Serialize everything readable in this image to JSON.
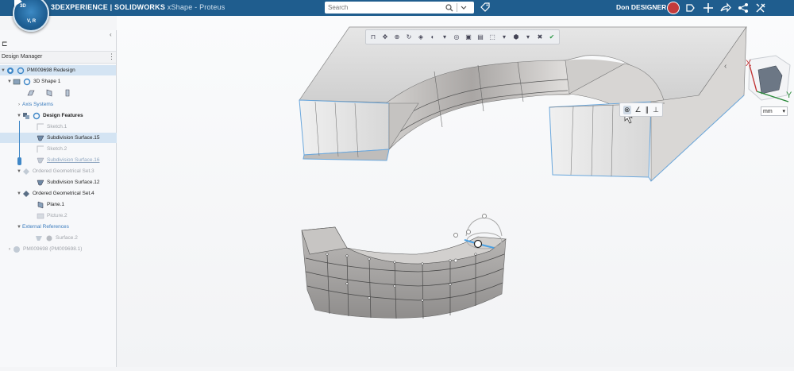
{
  "topbar": {
    "brand_strong": "3DEXPERIENCE | SOLIDWORKS",
    "brand_app": " xShape - Proteus",
    "compass_top": "3D",
    "compass_version": "V, R",
    "search_placeholder": "Search",
    "user_name": "Don DESIGNER",
    "icons": [
      "tag-icon",
      "share-icon",
      "plus-icon",
      "forward-icon",
      "network-icon",
      "tools-icon"
    ]
  },
  "sidebar": {
    "title": "Design Manager",
    "tree": [
      {
        "label": "PM009698 Redesign"
      },
      {
        "label": "3D Shape 1"
      },
      {
        "label": "Axis Systems"
      },
      {
        "label": "Design Features"
      },
      {
        "label": "Sketch.1"
      },
      {
        "label": "Subdivision Surface.15"
      },
      {
        "label": "Sketch.2"
      },
      {
        "label": "Subdivision Surface.16"
      },
      {
        "label": "Ordered Geometrical Set.3"
      },
      {
        "label": "Subdivision Surface.12"
      },
      {
        "label": "Ordered Geometrical Set.4"
      },
      {
        "label": "Plane.1"
      },
      {
        "label": "Picture.2"
      },
      {
        "label": "External References"
      },
      {
        "label": "Surface.2"
      },
      {
        "label": "PM009698 (PM009698.1)"
      }
    ]
  },
  "viewport": {
    "unit": "mm",
    "axis_x": "X",
    "axis_y": "Y"
  },
  "colors": {
    "topbar": "#1f5d8e",
    "selection": "#d4e4f3",
    "edge_blue": "#5aa5de"
  }
}
